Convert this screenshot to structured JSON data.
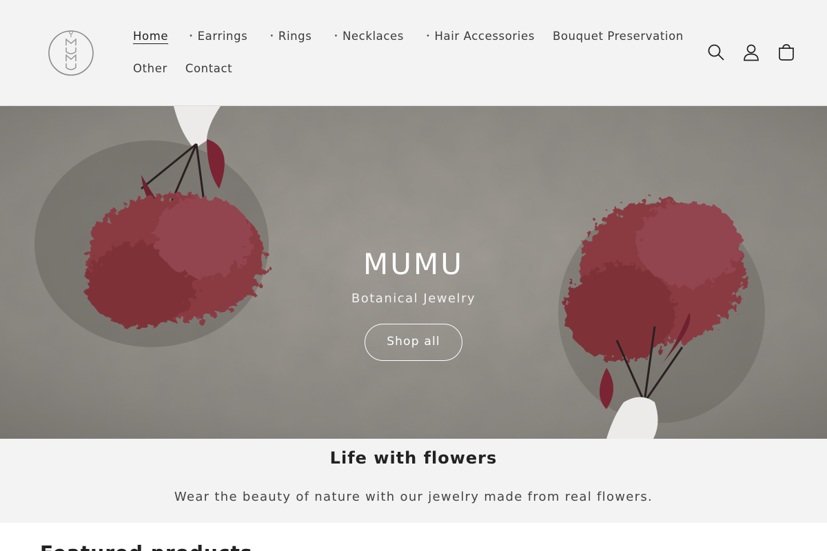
{
  "brand": {
    "logo_alt": "MUMU logo",
    "name": "MUMU"
  },
  "nav": {
    "row1": [
      {
        "label": "Home",
        "bullet": false,
        "active": true
      },
      {
        "label": "Earrings",
        "bullet": true
      },
      {
        "label": "Rings",
        "bullet": true
      },
      {
        "label": "Necklaces",
        "bullet": true
      },
      {
        "label": "Hair Accessories",
        "bullet": true
      },
      {
        "label": "Bouquet Preservation",
        "bullet": false
      }
    ],
    "row2": [
      {
        "label": "Other",
        "bullet": false
      },
      {
        "label": "Contact",
        "bullet": false
      }
    ],
    "bullet_char": "•"
  },
  "header_icons": [
    "search-icon",
    "account-icon",
    "cart-icon"
  ],
  "hero": {
    "title": "MUMU",
    "subtitle": "Botanical Jewelry",
    "button": "Shop all"
  },
  "intro": {
    "title": "Life with flowers",
    "text": "Wear the beauty of nature with our jewelry made from real flowers."
  },
  "featured": {
    "title": "Featured products"
  },
  "colors": {
    "page_bg": "#f3f3f3",
    "flower": "#8a3a42",
    "wall": "#8e8a84",
    "text": "#222222"
  }
}
